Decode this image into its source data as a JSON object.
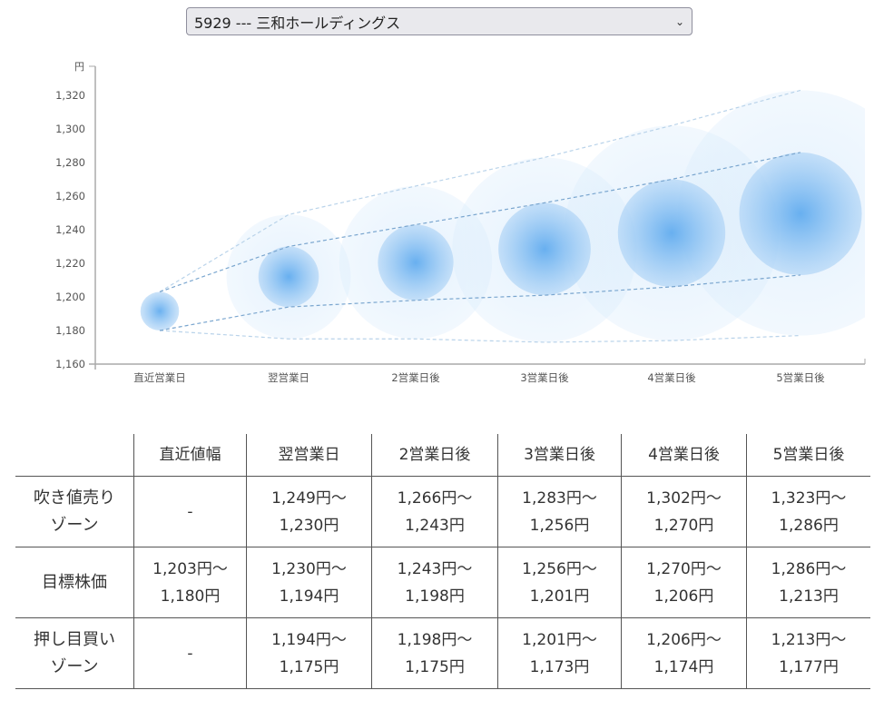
{
  "selector": {
    "value": "5929 --- 三和ホールディングス"
  },
  "chart_data": {
    "type": "bubble-range",
    "y_unit": "円",
    "ylim": [
      1160,
      1330
    ],
    "yticks": [
      1160,
      1180,
      1200,
      1220,
      1240,
      1260,
      1280,
      1300,
      1320
    ],
    "ytick_labels": [
      "1,160",
      "1,180",
      "1,200",
      "1,220",
      "1,240",
      "1,260",
      "1,280",
      "1,300",
      "1,320"
    ],
    "categories": [
      "直近営業日",
      "翌営業日",
      "2営業日後",
      "3営業日後",
      "4営業日後",
      "5営業日後"
    ],
    "sell_top": [
      1203,
      1249,
      1266,
      1283,
      1302,
      1323
    ],
    "target_high": [
      1203,
      1230,
      1243,
      1256,
      1270,
      1286
    ],
    "target_low": [
      1180,
      1194,
      1198,
      1201,
      1206,
      1213
    ],
    "buy_bottom": [
      1180,
      1175,
      1175,
      1173,
      1174,
      1177
    ],
    "colors": {
      "inner": "#5aa8ee",
      "outer": "#cfe6fb",
      "line_inner": "#7aa6cf",
      "line_outer": "#b9d3ea",
      "axis": "#aaaaaa"
    }
  },
  "table": {
    "headers": [
      "",
      "直近値幅",
      "翌営業日",
      "2営業日後",
      "3営業日後",
      "4営業日後",
      "5営業日後"
    ],
    "rows": [
      {
        "label": [
          "吹き値売り",
          "ゾーン"
        ],
        "cells": [
          [
            "-"
          ],
          [
            "1,249円～",
            "1,230円"
          ],
          [
            "1,266円～",
            "1,243円"
          ],
          [
            "1,283円～",
            "1,256円"
          ],
          [
            "1,302円～",
            "1,270円"
          ],
          [
            "1,323円～",
            "1,286円"
          ]
        ]
      },
      {
        "label": [
          "目標株価"
        ],
        "cells": [
          [
            "1,203円～",
            "1,180円"
          ],
          [
            "1,230円～",
            "1,194円"
          ],
          [
            "1,243円～",
            "1,198円"
          ],
          [
            "1,256円～",
            "1,201円"
          ],
          [
            "1,270円～",
            "1,206円"
          ],
          [
            "1,286円～",
            "1,213円"
          ]
        ]
      },
      {
        "label": [
          "押し目買い",
          "ゾーン"
        ],
        "cells": [
          [
            "-"
          ],
          [
            "1,194円～",
            "1,175円"
          ],
          [
            "1,198円～",
            "1,175円"
          ],
          [
            "1,201円～",
            "1,173円"
          ],
          [
            "1,206円～",
            "1,174円"
          ],
          [
            "1,213円～",
            "1,177円"
          ]
        ]
      }
    ]
  }
}
